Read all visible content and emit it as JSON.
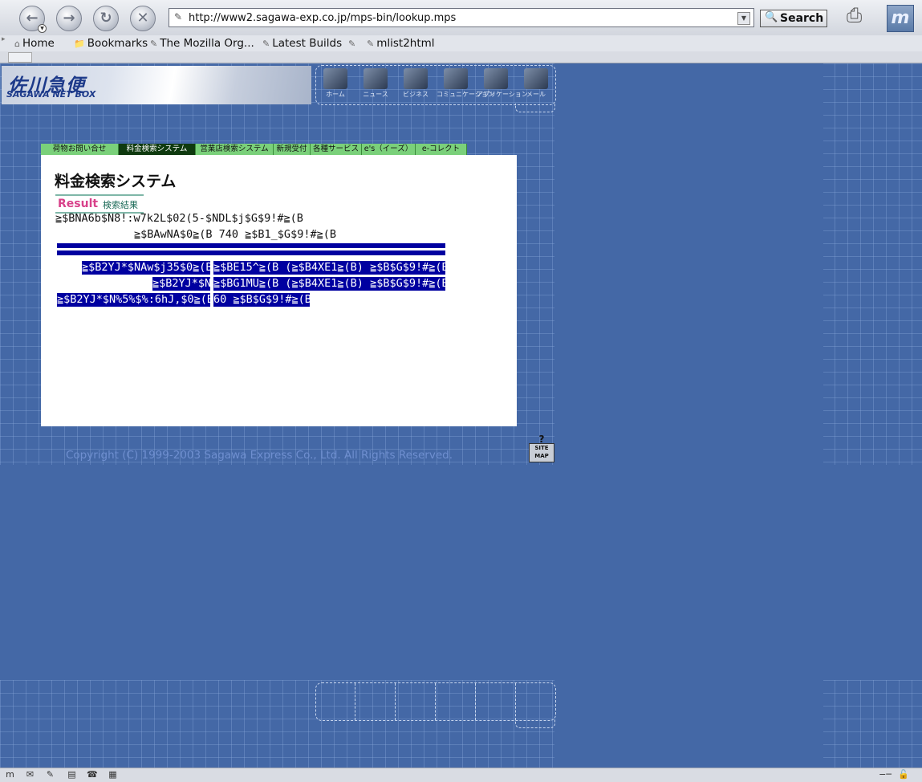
{
  "browser": {
    "url": "http://www2.sagawa-exp.co.jp/mps-bin/lookup.mps",
    "search_label": "Search",
    "personal_toolbar": [
      "Home",
      "Bookmarks",
      "The Mozilla Org...",
      "Latest Builds",
      "mlist2html"
    ],
    "mozilla_logo": "m"
  },
  "site": {
    "brand_jp": "佐川急便",
    "brand_en": "SAGAWA NET BOX",
    "icon_nav": [
      "ホーム",
      "ニュース",
      "ビジネス",
      "コミュニケーション",
      "アプリケーション",
      "メール"
    ],
    "section_tabs": [
      "荷物お問い合せ",
      "料金検索システム",
      "営業店検索システム",
      "新規受付",
      "各種サービス",
      "e's（イーズ）",
      "e-コレクト"
    ],
    "active_tab": "料金検索システム",
    "page_title": "料金検索システム",
    "result_en": "Result",
    "result_jp": "検索結果",
    "garbled_lines": [
      "≧$BNA6b$N8!:w7k2L$02(5-$NDL$j$G$9!#≧(B",
      "≧$BAwNA$0≧(B 740 ≧$B1_$G$9!#≧(B"
    ],
    "highlight_rows": [
      [
        "≧$B2YJ*$NAw$j35$0≧(B",
        "≧$BE15^≧(B (≧$B4XE1≧(B) ≧$B$G$9!#≧(B"
      ],
      [
        "≧$B2YJ*$N",
        "≧$BG1MU≧(B (≧$B4XE1≧(B) ≧$B$G$9!#≧(B"
      ],
      [
        "≧$B2YJ*$N%5%$%:6hJ,$0≧(B",
        "60 ≧$B$G$9!#≧(B"
      ]
    ],
    "copyright": "Copyright (C) 1999-2003 Sagawa Express Co., Ltd. All Rights Reserved.",
    "sitemap_q": "?",
    "sitemap_label": "SITE MAP"
  }
}
